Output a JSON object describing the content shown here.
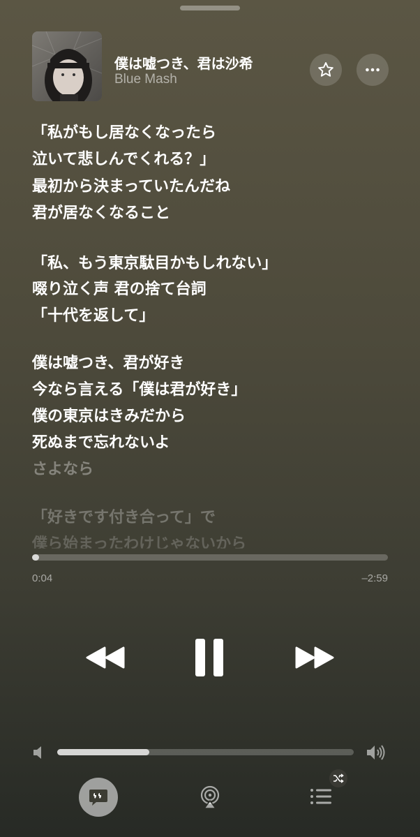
{
  "now_playing": {
    "title": "僕は嘘つき、君は沙希",
    "artist": "Blue Mash"
  },
  "actions": {
    "favorite_icon": "star-icon",
    "more_icon": "ellipsis-icon"
  },
  "lyrics": {
    "stanzas": [
      [
        "「私がもし居なくなったら",
        "泣いて悲しんでくれる？」",
        "最初から決まっていたんだね",
        "君が居なくなること"
      ],
      [
        "「私、もう東京駄目かもしれない」",
        "啜り泣く声 君の捨て台詞",
        "「十代を返して」"
      ],
      [
        "僕は嘘つき、君が好き",
        "今なら言える「僕は君が好き」",
        "僕の東京はきみだから",
        "死ぬまで忘れないよ",
        "さよなら"
      ],
      [
        "「好きです付き合って」で",
        "僕ら始まったわけじゃないから"
      ]
    ]
  },
  "playback": {
    "progress_fraction": 0.018,
    "elapsed": "0:04",
    "remaining": "–2:59",
    "rewind_icon": "rewind-icon",
    "pause_icon": "pause-icon",
    "forward_icon": "fast-forward-icon"
  },
  "volume": {
    "level_fraction": 0.31,
    "min_icon": "speaker-low-icon",
    "max_icon": "speaker-high-icon"
  },
  "bottom_bar": {
    "lyrics_icon": "lyrics-quote-icon",
    "airplay_icon": "airplay-icon",
    "queue_icon": "queue-list-icon",
    "shuffle_badge_icon": "shuffle-icon"
  }
}
